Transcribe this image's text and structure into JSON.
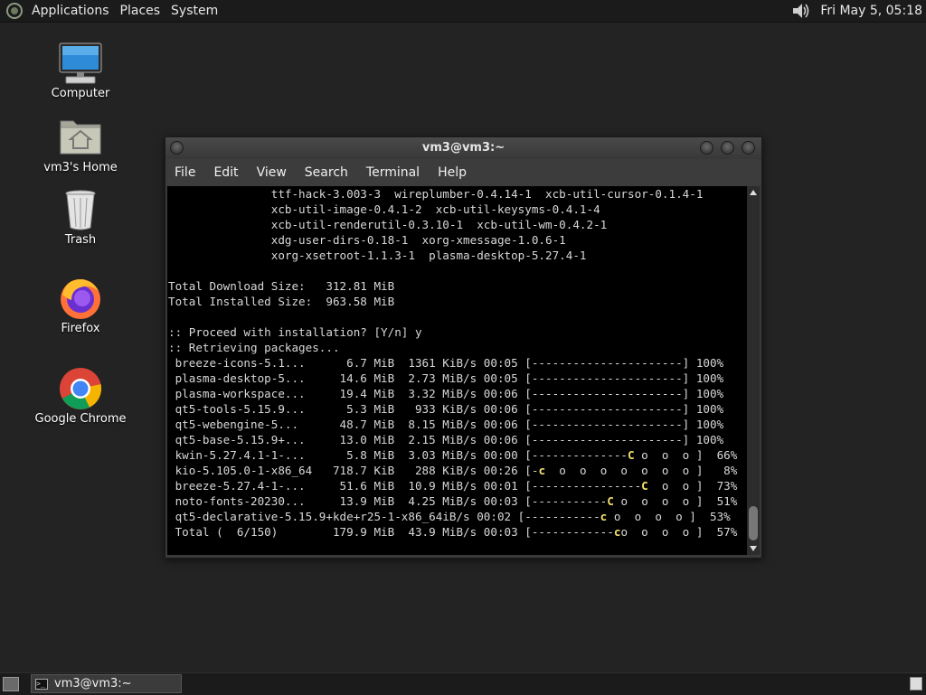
{
  "top_panel": {
    "menus": [
      "Applications",
      "Places",
      "System"
    ],
    "clock": "Fri May  5, 05:18",
    "volume_icon": "speaker-icon"
  },
  "desktop_icons": [
    {
      "label": "Computer",
      "icon": "computer-icon"
    },
    {
      "label": "vm3's Home",
      "icon": "home-folder-icon"
    },
    {
      "label": "Trash",
      "icon": "trash-icon"
    },
    {
      "label": "Firefox",
      "icon": "firefox-icon"
    },
    {
      "label": "Google Chrome",
      "icon": "chrome-icon"
    }
  ],
  "window": {
    "title": "vm3@vm3:~",
    "menu": [
      "File",
      "Edit",
      "View",
      "Search",
      "Terminal",
      "Help"
    ],
    "terminal_lines": [
      {
        "text": "               ttf-hack-3.003-3  wireplumber-0.4.14-1  xcb-util-cursor-0.1.4-1"
      },
      {
        "text": "               xcb-util-image-0.4.1-2  xcb-util-keysyms-0.4.1-4"
      },
      {
        "text": "               xcb-util-renderutil-0.3.10-1  xcb-util-wm-0.4.2-1"
      },
      {
        "text": "               xdg-user-dirs-0.18-1  xorg-xmessage-1.0.6-1"
      },
      {
        "text": "               xorg-xsetroot-1.1.3-1  plasma-desktop-5.27.4-1"
      },
      {
        "text": ""
      },
      {
        "text": "Total Download Size:   312.81 MiB"
      },
      {
        "text": "Total Installed Size:  963.58 MiB"
      },
      {
        "text": ""
      },
      {
        "text": ":: Proceed with installation? [Y/n] y"
      },
      {
        "text": ":: Retrieving packages..."
      },
      {
        "text": " breeze-icons-5.1...      6.7 MiB  1361 KiB/s 00:05 [----------------------] 100%"
      },
      {
        "text": " plasma-desktop-5...     14.6 MiB  2.73 MiB/s 00:05 [----------------------] 100%"
      },
      {
        "text": " plasma-workspace...     19.4 MiB  3.32 MiB/s 00:06 [----------------------] 100%"
      },
      {
        "text": " qt5-tools-5.15.9...      5.3 MiB   933 KiB/s 00:06 [----------------------] 100%"
      },
      {
        "text": " qt5-webengine-5...      48.7 MiB  8.15 MiB/s 00:06 [----------------------] 100%"
      },
      {
        "text": " qt5-base-5.15.9+...     13.0 MiB  2.15 MiB/s 00:06 [----------------------] 100%"
      },
      {
        "pre": " kwin-5.27.4.1-1-...      5.8 MiB  3.03 MiB/s 00:00 [--------------",
        "pac": "C",
        "post": " o  o  o ]  66%"
      },
      {
        "pre": " kio-5.105.0-1-x86_64   718.7 KiB   288 KiB/s 00:26 [-",
        "pac": "c",
        "post": "  o  o  o  o  o  o  o ]   8%"
      },
      {
        "pre": " breeze-5.27.4-1-...     51.6 MiB  10.9 MiB/s 00:01 [----------------",
        "pac": "C",
        "post": "  o  o ]  73%"
      },
      {
        "pre": " noto-fonts-20230...     13.9 MiB  4.25 MiB/s 00:03 [-----------",
        "pac": "C",
        "post": " o  o  o  o ]  51%"
      },
      {
        "pre": " qt5-declarative-5.15.9+kde+r25-1-x86_64iB/s 00:02 [-----------",
        "pac": "c",
        "post": " o  o  o  o ]  53%"
      },
      {
        "pre": " Total (  6/150)        179.9 MiB  43.9 MiB/s 00:03 [------------",
        "pac": "c",
        "post": "o  o  o  o ]  57%"
      }
    ]
  },
  "taskbar": {
    "task_label": "vm3@vm3:~"
  },
  "colors": {
    "panel_bg": "#1b1b1b",
    "desktop_bg": "#232323",
    "terminal_bg": "#000000",
    "terminal_fg": "#d8d8d8",
    "pacman_yellow": "#f5e36a"
  }
}
